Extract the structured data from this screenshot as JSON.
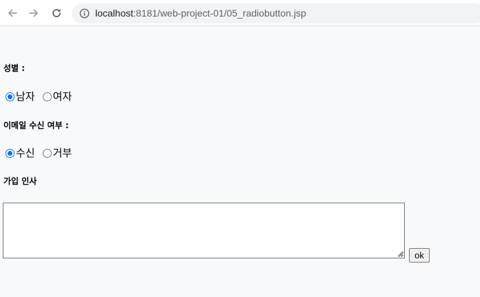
{
  "browser": {
    "url_host": "localhost",
    "url_path": ":8181/web-project-01/05_radiobutton.jsp",
    "icons": [
      "back-arrow-icon",
      "forward-arrow-icon",
      "reload-icon",
      "info-icon"
    ]
  },
  "form": {
    "gender": {
      "heading": "성별 :",
      "options": [
        {
          "label": "남자",
          "checked": true
        },
        {
          "label": "여자",
          "checked": false
        }
      ]
    },
    "email": {
      "heading": "이메일 수신 여부 :",
      "options": [
        {
          "label": "수신",
          "checked": true
        },
        {
          "label": "거부",
          "checked": false
        }
      ]
    },
    "greeting": {
      "heading": "가입 인사",
      "textarea_value": ""
    },
    "submit_label": "ok"
  },
  "colors": {
    "radio_checked": "#0075ff",
    "page_background": "#f8f9fb"
  }
}
